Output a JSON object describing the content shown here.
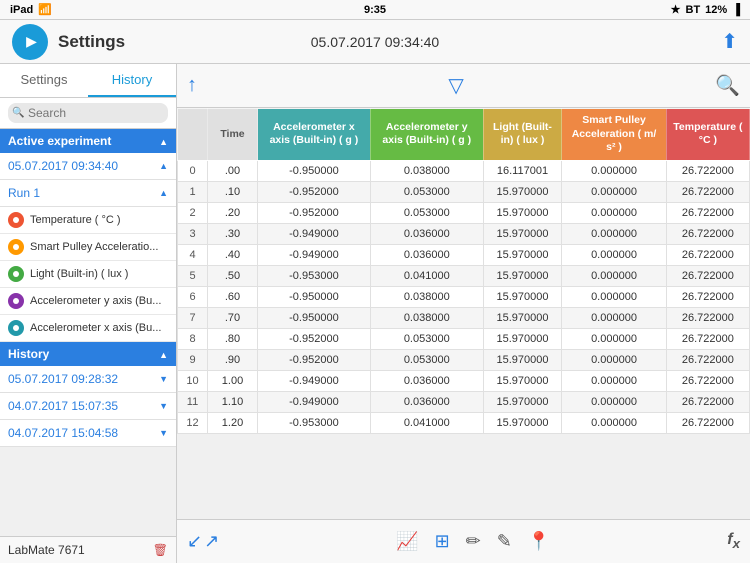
{
  "statusBar": {
    "left": "iPad",
    "wifi": "WiFi",
    "time": "9:35",
    "bluetooth": "BT",
    "battery": "12%"
  },
  "header": {
    "title": "Settings",
    "datetime": "05.07.2017 09:34:40"
  },
  "sidebar": {
    "tabs": [
      {
        "id": "settings",
        "label": "Settings"
      },
      {
        "id": "history",
        "label": "History"
      }
    ],
    "activeTab": "history",
    "searchPlaceholder": "Search",
    "sections": {
      "activeExperiment": {
        "label": "Active experiment",
        "date": "05.07.2017 09:34:40",
        "run": "Run 1",
        "sensors": [
          {
            "label": "Temperature ( °C )",
            "color": "red"
          },
          {
            "label": "Smart Pulley Acceleratio...",
            "color": "orange"
          },
          {
            "label": "Light (Built-in) ( lux )",
            "color": "green"
          },
          {
            "label": "Accelerometer y axis (Bu...",
            "color": "purple"
          },
          {
            "label": "Accelerometer x axis (Bu...",
            "color": "blue"
          }
        ]
      },
      "history": {
        "label": "History",
        "items": [
          "05.07.2017 09:28:32",
          "04.07.2017 15:07:35",
          "04.07.2017 15:04:58"
        ]
      }
    },
    "bottomDevice": "LabMate 7671"
  },
  "table": {
    "columns": [
      {
        "id": "row",
        "label": "",
        "class": "row-num-header"
      },
      {
        "id": "time",
        "label": "Time",
        "class": "time-header"
      },
      {
        "id": "accelX",
        "label": "Accelerometer x axis (Built-in) ( g )",
        "class": "accel-x"
      },
      {
        "id": "accelY",
        "label": "Accelerometer y axis (Built-in) ( g )",
        "class": "accel-y"
      },
      {
        "id": "light",
        "label": "Light (Built-in) ( lux )",
        "class": "light"
      },
      {
        "id": "smartPulley",
        "label": "Smart Pulley Acceleration ( m/ s² )",
        "class": "smart-pulley"
      },
      {
        "id": "temperature",
        "label": "Temperature ( °C )",
        "class": "temperature"
      }
    ],
    "rows": [
      {
        "row": 0,
        "time": ".00",
        "accelX": "-0.950000",
        "accelY": "0.038000",
        "light": "16.117001",
        "smartPulley": "0.000000",
        "temperature": "26.722000"
      },
      {
        "row": 1,
        "time": ".10",
        "accelX": "-0.952000",
        "accelY": "0.053000",
        "light": "15.970000",
        "smartPulley": "0.000000",
        "temperature": "26.722000"
      },
      {
        "row": 2,
        "time": ".20",
        "accelX": "-0.952000",
        "accelY": "0.053000",
        "light": "15.970000",
        "smartPulley": "0.000000",
        "temperature": "26.722000"
      },
      {
        "row": 3,
        "time": ".30",
        "accelX": "-0.949000",
        "accelY": "0.036000",
        "light": "15.970000",
        "smartPulley": "0.000000",
        "temperature": "26.722000"
      },
      {
        "row": 4,
        "time": ".40",
        "accelX": "-0.949000",
        "accelY": "0.036000",
        "light": "15.970000",
        "smartPulley": "0.000000",
        "temperature": "26.722000"
      },
      {
        "row": 5,
        "time": ".50",
        "accelX": "-0.953000",
        "accelY": "0.041000",
        "light": "15.970000",
        "smartPulley": "0.000000",
        "temperature": "26.722000"
      },
      {
        "row": 6,
        "time": ".60",
        "accelX": "-0.950000",
        "accelY": "0.038000",
        "light": "15.970000",
        "smartPulley": "0.000000",
        "temperature": "26.722000"
      },
      {
        "row": 7,
        "time": ".70",
        "accelX": "-0.950000",
        "accelY": "0.038000",
        "light": "15.970000",
        "smartPulley": "0.000000",
        "temperature": "26.722000"
      },
      {
        "row": 8,
        "time": ".80",
        "accelX": "-0.952000",
        "accelY": "0.053000",
        "light": "15.970000",
        "smartPulley": "0.000000",
        "temperature": "26.722000"
      },
      {
        "row": 9,
        "time": ".90",
        "accelX": "-0.952000",
        "accelY": "0.053000",
        "light": "15.970000",
        "smartPulley": "0.000000",
        "temperature": "26.722000"
      },
      {
        "row": 10,
        "time": "1.00",
        "accelX": "-0.949000",
        "accelY": "0.036000",
        "light": "15.970000",
        "smartPulley": "0.000000",
        "temperature": "26.722000"
      },
      {
        "row": 11,
        "time": "1.10",
        "accelX": "-0.949000",
        "accelY": "0.036000",
        "light": "15.970000",
        "smartPulley": "0.000000",
        "temperature": "26.722000"
      },
      {
        "row": 12,
        "time": "1.20",
        "accelX": "-0.953000",
        "accelY": "0.041000",
        "light": "15.970000",
        "smartPulley": "0.000000",
        "temperature": "26.722000"
      }
    ]
  },
  "bottomToolbar": {
    "icons": [
      "chart",
      "grid",
      "pencil",
      "edit2",
      "pin",
      "fx"
    ]
  }
}
